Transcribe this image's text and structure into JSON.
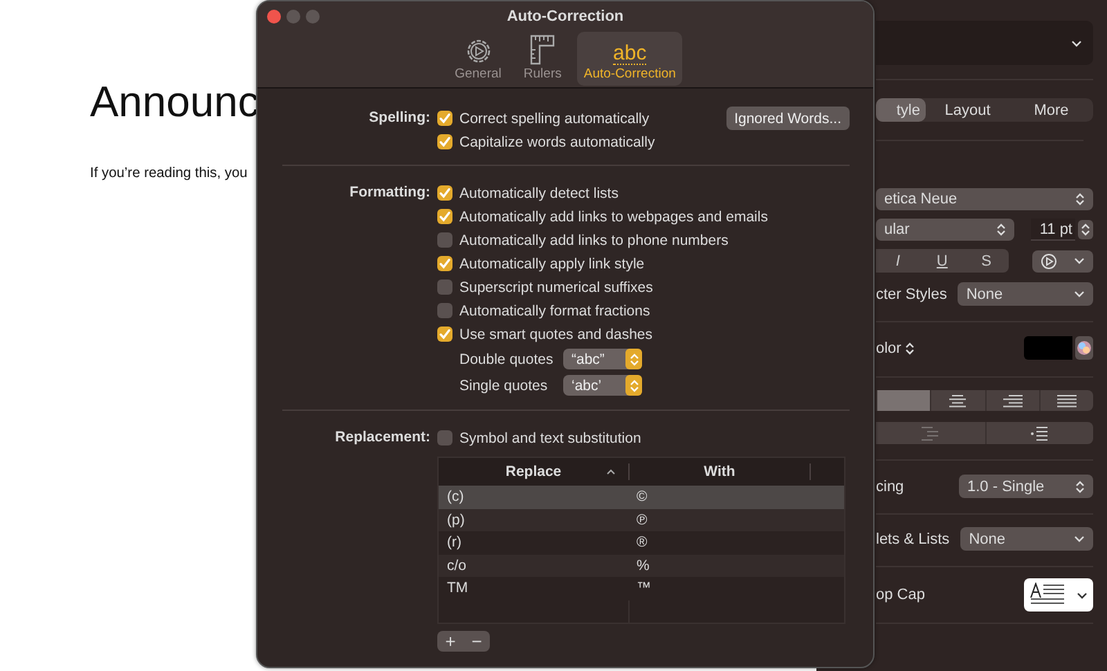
{
  "document": {
    "heading": "Announc",
    "body": "If you’re reading this, you"
  },
  "dialog": {
    "title": "Auto-Correction",
    "toolbar": [
      {
        "kind": "gear",
        "label": "General",
        "selected": false
      },
      {
        "kind": "ruler",
        "label": "Rulers",
        "selected": false
      },
      {
        "kind": "glyph",
        "glyph": "abc",
        "label": "Auto-Correction",
        "selected": true
      }
    ],
    "spelling": {
      "label": "Spelling:",
      "button": "Ignored Words...",
      "options": [
        {
          "label": "Correct spelling automatically",
          "checked": true
        },
        {
          "label": "Capitalize words automatically",
          "checked": true
        }
      ]
    },
    "formatting": {
      "label": "Formatting:",
      "options": [
        {
          "label": "Automatically detect lists",
          "checked": true
        },
        {
          "label": "Automatically add links to webpages and emails",
          "checked": true
        },
        {
          "label": "Automatically add links to phone numbers",
          "checked": false
        },
        {
          "label": "Automatically apply link style",
          "checked": true
        },
        {
          "label": "Superscript numerical suffixes",
          "checked": false
        },
        {
          "label": "Automatically format fractions",
          "checked": false
        },
        {
          "label": "Use smart quotes and dashes",
          "checked": true
        }
      ],
      "quotes": [
        {
          "label": "Double quotes",
          "value": "“abc”"
        },
        {
          "label": "Single quotes",
          "value": "‘abc’"
        }
      ]
    },
    "replacement": {
      "label": "Replacement:",
      "option": {
        "label": "Symbol and text substitution",
        "checked": false
      },
      "columns": [
        "Replace",
        "With"
      ],
      "rows": [
        {
          "replace": "(c)",
          "with": "©",
          "selected": true
        },
        {
          "replace": "(p)",
          "with": "℗",
          "selected": false
        },
        {
          "replace": "(r)",
          "with": "®",
          "selected": false
        },
        {
          "replace": "c/o",
          "with": "%",
          "selected": false
        },
        {
          "replace": "TM",
          "with": "™",
          "selected": false
        }
      ],
      "buttons": [
        "+",
        "−"
      ]
    }
  },
  "inspector": {
    "tabs": [
      {
        "label": "tyle",
        "selected": true
      },
      {
        "label": "Layout",
        "selected": false
      },
      {
        "label": "More",
        "selected": false
      }
    ],
    "font": "etica Neue",
    "typeface": "ular",
    "size": "11 pt",
    "styles": [
      "I",
      "U",
      "S"
    ],
    "character_styles": {
      "label": "cter Styles",
      "value": "None"
    },
    "color_label": "olor",
    "alignment": [
      {
        "kind": "left",
        "selected": true
      },
      {
        "kind": "center",
        "selected": false
      },
      {
        "kind": "right",
        "selected": false
      },
      {
        "kind": "justify",
        "selected": false
      }
    ],
    "indent": [
      {
        "kind": "decrease",
        "disabled": true
      },
      {
        "kind": "increase",
        "disabled": false
      }
    ],
    "spacing": {
      "label": "cing",
      "value": "1.0 - Single"
    },
    "bullets": {
      "label": "lets & Lists",
      "value": "None"
    },
    "drop_cap": {
      "label": "op Cap"
    }
  }
}
